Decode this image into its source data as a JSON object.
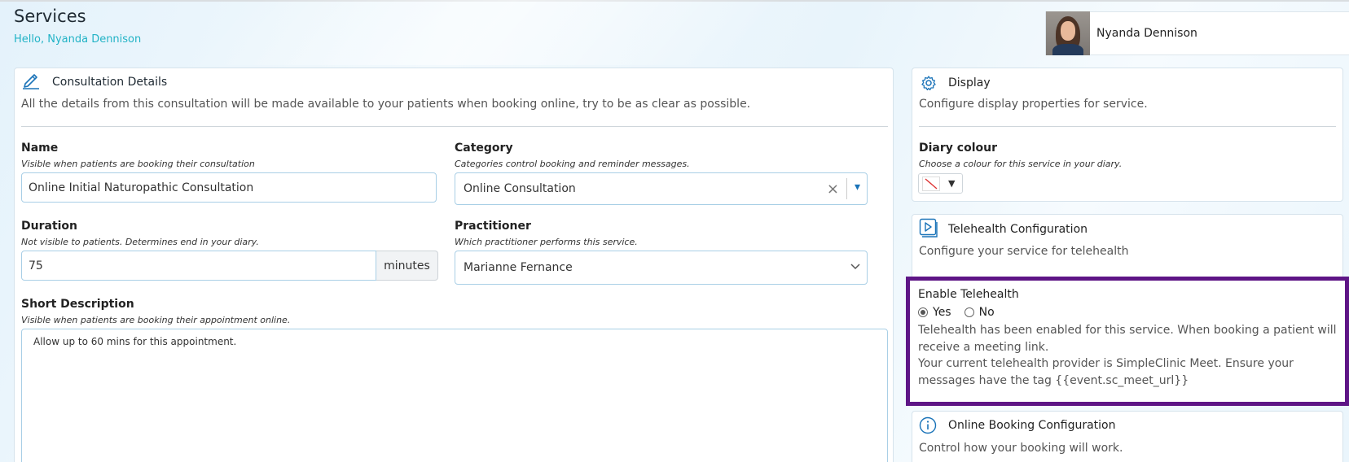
{
  "header": {
    "title": "Services",
    "greeting": "Hello, Nyanda Dennison",
    "user_name": "Nyanda Dennison"
  },
  "consultation": {
    "title": "Consultation Details",
    "description": "All the details from this consultation will be made available to your patients when booking online, try to be as clear as possible.",
    "icon": "pencil-icon",
    "name": {
      "label": "Name",
      "help": "Visible when patients are booking their consultation",
      "value": "Online Initial Naturopathic Consultation"
    },
    "category": {
      "label": "Category",
      "help": "Categories control booking and reminder messages.",
      "value": "Online Consultation",
      "clear_glyph": "×",
      "caret_glyph": "▾"
    },
    "duration": {
      "label": "Duration",
      "help": "Not visible to patients. Determines end in your diary.",
      "value": "75",
      "unit": "minutes"
    },
    "practitioner": {
      "label": "Practitioner",
      "help": "Which practitioner performs this service.",
      "value": "Marianne Fernance"
    },
    "short_description": {
      "label": "Short Description",
      "help": "Visible when patients are booking their appointment online.",
      "value": "Allow up to 60 mins for this appointment."
    }
  },
  "display": {
    "title": "Display",
    "description": "Configure display properties for service.",
    "icon": "gear-icon",
    "diary_colour": {
      "label": "Diary colour",
      "help": "Choose a colour for this service in your diary.",
      "caret_glyph": "▼"
    }
  },
  "telehealth": {
    "title": "Telehealth Configuration",
    "description": "Configure your service for telehealth",
    "icon": "video-icon",
    "enable_label": "Enable Telehealth",
    "options": [
      "Yes",
      "No"
    ],
    "selected": "Yes",
    "info_1": "Telehealth has been enabled for this service. When booking a patient will receive a meeting link.",
    "info_2": "Your current telehealth provider is SimpleClinic Meet. Ensure your messages have the tag {{event.sc_meet_url}}",
    "highlight_color": "#5e1586"
  },
  "online_booking": {
    "title": "Online Booking Configuration",
    "description": "Control how your booking will work.",
    "icon": "info-icon"
  },
  "colors": {
    "accent": "#22b3c6",
    "icon_blue": "#1a73b8",
    "input_border": "#a9cfe6"
  }
}
